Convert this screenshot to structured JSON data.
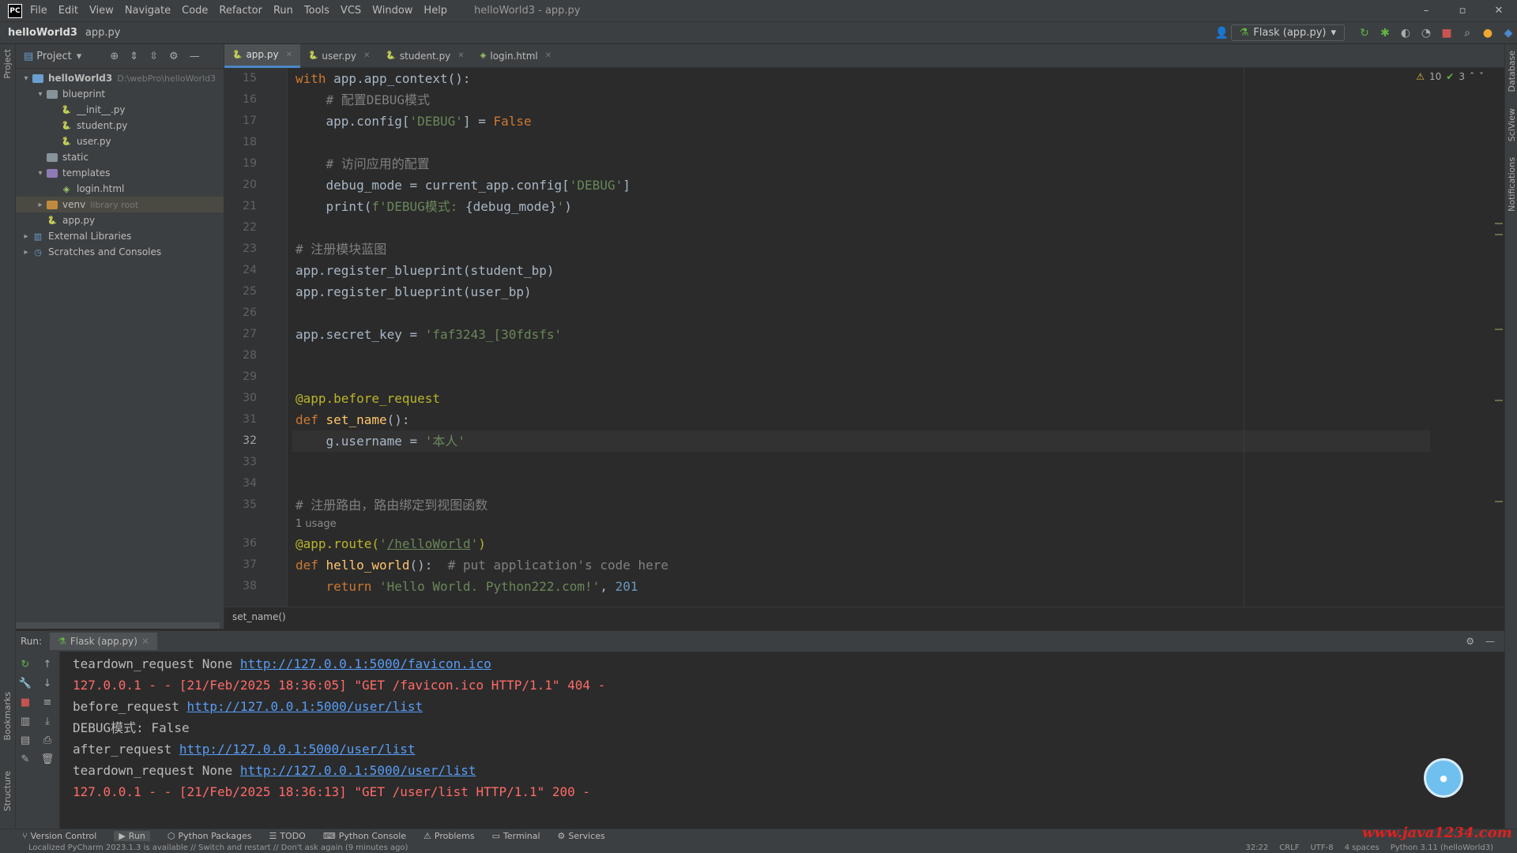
{
  "menubar": {
    "items": [
      "File",
      "Edit",
      "View",
      "Navigate",
      "Code",
      "Refactor",
      "Run",
      "Tools",
      "VCS",
      "Window",
      "Help"
    ],
    "window_title": "helloWorld3 - app.py"
  },
  "navbar": {
    "project": "helloWorld3",
    "file": "app.py",
    "run_config": "Flask (app.py)"
  },
  "project_panel": {
    "title": "Project",
    "tree": [
      {
        "label": "helloWorld3",
        "hint": "D:\\webPro\\helloWorld3",
        "depth": 0,
        "type": "folder",
        "open": true
      },
      {
        "label": "blueprint",
        "depth": 1,
        "type": "folder",
        "open": true
      },
      {
        "label": "__init__.py",
        "depth": 2,
        "type": "py"
      },
      {
        "label": "student.py",
        "depth": 2,
        "type": "py"
      },
      {
        "label": "user.py",
        "depth": 2,
        "type": "py"
      },
      {
        "label": "static",
        "depth": 1,
        "type": "folder"
      },
      {
        "label": "templates",
        "depth": 1,
        "type": "folder-purple",
        "open": true
      },
      {
        "label": "login.html",
        "depth": 2,
        "type": "html"
      },
      {
        "label": "venv",
        "hint": "library root",
        "depth": 1,
        "type": "folder-orange",
        "selected": true
      },
      {
        "label": "app.py",
        "depth": 1,
        "type": "py"
      },
      {
        "label": "External Libraries",
        "depth": 0,
        "type": "lib"
      },
      {
        "label": "Scratches and Consoles",
        "depth": 0,
        "type": "scratch"
      }
    ]
  },
  "tabs": [
    {
      "label": "app.py",
      "active": true
    },
    {
      "label": "user.py"
    },
    {
      "label": "student.py"
    },
    {
      "label": "login.html"
    }
  ],
  "editor": {
    "inspections": {
      "warnings": "10",
      "ok": "3"
    },
    "lines": [
      {
        "n": "15",
        "html": "<span class=\"kw\">with</span> app.app_context():"
      },
      {
        "n": "16",
        "html": "    <span class=\"cm\"># 配置DEBUG模式</span>"
      },
      {
        "n": "17",
        "html": "    app.config[<span class=\"st\">'DEBUG'</span>] = <span class=\"kw\">False</span>"
      },
      {
        "n": "18",
        "html": ""
      },
      {
        "n": "19",
        "html": "    <span class=\"cm\"># 访问应用的配置</span>"
      },
      {
        "n": "20",
        "html": "    debug_mode = current_app.config[<span class=\"st\">'DEBUG'</span>]"
      },
      {
        "n": "21",
        "html": "    print(<span class=\"st\">f'DEBUG模式: </span>{debug_mode}<span class=\"st\">'</span>)"
      },
      {
        "n": "22",
        "html": ""
      },
      {
        "n": "23",
        "html": "<span class=\"cm\"># 注册模块蓝图</span>"
      },
      {
        "n": "24",
        "html": "app.register_blueprint(student_bp)"
      },
      {
        "n": "25",
        "html": "app.register_blueprint(user_bp)"
      },
      {
        "n": "26",
        "html": ""
      },
      {
        "n": "27",
        "html": "app.secret_key = <span class=\"st\">'faf3243_[30fdsfs'</span>"
      },
      {
        "n": "28",
        "html": ""
      },
      {
        "n": "29",
        "html": ""
      },
      {
        "n": "30",
        "html": "<span class=\"dc\">@app.before_request</span>"
      },
      {
        "n": "31",
        "html": "<span class=\"kw\">def</span> <span class=\"fn\">set_name</span>():"
      },
      {
        "n": "32",
        "html": "    g.username = <span class=\"st\">'本人'</span>",
        "current": true
      },
      {
        "n": "33",
        "html": ""
      },
      {
        "n": "34",
        "html": ""
      },
      {
        "n": "35",
        "html": "<span class=\"cm\"># 注册路由，路由绑定到视图函数</span>"
      },
      {
        "n": "",
        "html": "1 usage",
        "usage": true
      },
      {
        "n": "36",
        "html": "<span class=\"dc\">@app.route(</span><span class=\"st\">'</span><span class=\"lk\">/helloWorld</span><span class=\"st\">'</span><span class=\"dc\">)</span>"
      },
      {
        "n": "37",
        "html": "<span class=\"kw\">def</span> <span class=\"fn\">hello_world</span>():  <span class=\"cm\"># put application's code here</span>"
      },
      {
        "n": "38",
        "html": "    <span class=\"kw\">return</span> <span class=\"st\">'Hello World. Python222.com!'</span>, <span class=\"nm\">201</span>"
      }
    ]
  },
  "breadcrumb": "set_name()",
  "run_panel": {
    "label": "Run:",
    "tab": "Flask (app.py)",
    "console": [
      {
        "text": "teardown_request None ",
        "link": "http://127.0.0.1:5000/favicon.ico",
        "err": false
      },
      {
        "text": "127.0.0.1 - - [21/Feb/2025 18:36:05] \"GET /favicon.ico HTTP/1.1\" 404 -",
        "err": true
      },
      {
        "text": "before_request ",
        "link": "http://127.0.0.1:5000/user/list",
        "err": false
      },
      {
        "text": "DEBUG模式: False",
        "err": false
      },
      {
        "text": "after_request ",
        "link": "http://127.0.0.1:5000/user/list",
        "err": false
      },
      {
        "text": "teardown_request None ",
        "link": "http://127.0.0.1:5000/user/list",
        "err": false
      },
      {
        "text": "127.0.0.1 - - [21/Feb/2025 18:36:13] \"GET /user/list HTTP/1.1\" 200 -",
        "err": true
      }
    ]
  },
  "bottom_tools": [
    "Version Control",
    "Run",
    "Python Packages",
    "TODO",
    "Python Console",
    "Problems",
    "Terminal",
    "Services"
  ],
  "status": {
    "message": "Localized PyCharm 2023.1.3 is available // Switch and restart // Don't ask again (9 minutes ago)",
    "position": "32:22",
    "line_sep": "CRLF",
    "encoding": "UTF-8",
    "indent": "4 spaces",
    "interpreter": "Python 3.11 (helloWorld3)"
  },
  "watermark": "www.java1234.com",
  "colors": {
    "accent": "#4a88c7",
    "keyword": "#cc7832",
    "string": "#6a8759",
    "error": "#ff6b68",
    "link": "#589df6"
  }
}
